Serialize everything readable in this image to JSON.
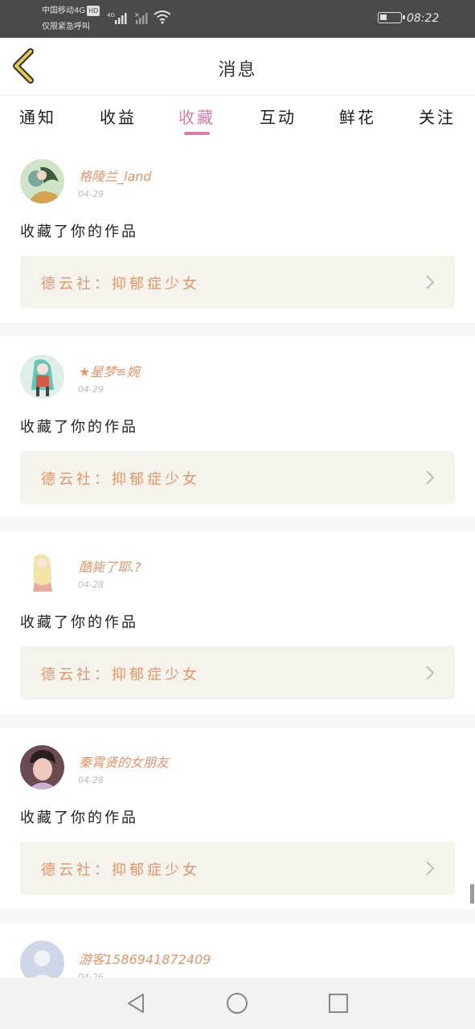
{
  "status_bar": {
    "carrier": "中国移动4G",
    "hd_badge": "HD",
    "network": "4G",
    "emergency_text": "仅限紧急呼叫",
    "time": "08:22",
    "battery_icon": "battery-icon",
    "wifi_icon": "wifi-icon",
    "signal_icon": "signal-icon"
  },
  "header": {
    "title": "消息",
    "back_icon": "back-arrow-icon",
    "accent": "#e6c84a"
  },
  "tabs": [
    {
      "label": "通知",
      "active": false
    },
    {
      "label": "收益",
      "active": false
    },
    {
      "label": "收藏",
      "active": true
    },
    {
      "label": "互动",
      "active": false
    },
    {
      "label": "鲜花",
      "active": false
    },
    {
      "label": "关注",
      "active": false
    }
  ],
  "colors": {
    "tab_active": "#e07aa6",
    "username": "#e6956a",
    "work_box_bg": "#f5f4ec"
  },
  "notifications": [
    {
      "username": "格陵兰_land",
      "date": "04-29",
      "action": "收藏了你的作品",
      "work": "德云社：抑郁症少女"
    },
    {
      "username": "★星梦≌婉",
      "date": "04-29",
      "action": "收藏了你的作品",
      "work": "德云社：抑郁症少女"
    },
    {
      "username": "酷毙了耶.?",
      "date": "04-28",
      "action": "收藏了你的作品",
      "work": "德云社：抑郁症少女"
    },
    {
      "username": "秦霄贤的女朋友",
      "date": "04-28",
      "action": "收藏了你的作品",
      "work": "德云社：抑郁症少女"
    },
    {
      "username": "游客1586941872409",
      "date": "04-26",
      "action": "",
      "work": ""
    }
  ],
  "nav_bar": {
    "back_icon": "nav-back-icon",
    "home_icon": "nav-home-icon",
    "recents_icon": "nav-recents-icon"
  }
}
